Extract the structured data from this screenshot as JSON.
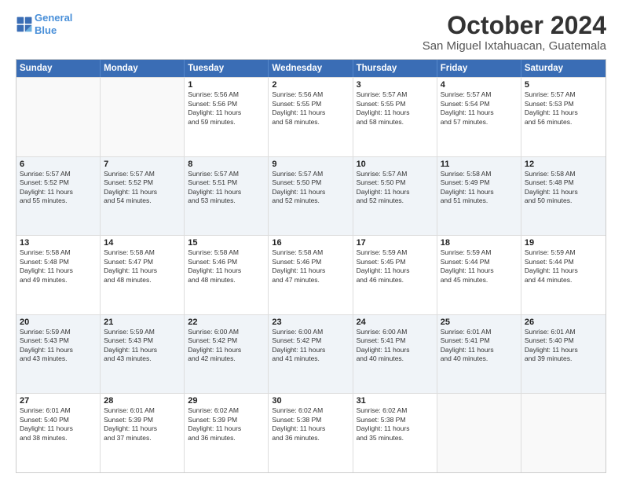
{
  "logo": {
    "line1": "General",
    "line2": "Blue"
  },
  "header": {
    "month": "October 2024",
    "location": "San Miguel Ixtahuacan, Guatemala"
  },
  "weekdays": [
    "Sunday",
    "Monday",
    "Tuesday",
    "Wednesday",
    "Thursday",
    "Friday",
    "Saturday"
  ],
  "rows": [
    {
      "alt": false,
      "cells": [
        {
          "day": "",
          "lines": []
        },
        {
          "day": "",
          "lines": []
        },
        {
          "day": "1",
          "lines": [
            "Sunrise: 5:56 AM",
            "Sunset: 5:56 PM",
            "Daylight: 11 hours",
            "and 59 minutes."
          ]
        },
        {
          "day": "2",
          "lines": [
            "Sunrise: 5:56 AM",
            "Sunset: 5:55 PM",
            "Daylight: 11 hours",
            "and 58 minutes."
          ]
        },
        {
          "day": "3",
          "lines": [
            "Sunrise: 5:57 AM",
            "Sunset: 5:55 PM",
            "Daylight: 11 hours",
            "and 58 minutes."
          ]
        },
        {
          "day": "4",
          "lines": [
            "Sunrise: 5:57 AM",
            "Sunset: 5:54 PM",
            "Daylight: 11 hours",
            "and 57 minutes."
          ]
        },
        {
          "day": "5",
          "lines": [
            "Sunrise: 5:57 AM",
            "Sunset: 5:53 PM",
            "Daylight: 11 hours",
            "and 56 minutes."
          ]
        }
      ]
    },
    {
      "alt": true,
      "cells": [
        {
          "day": "6",
          "lines": [
            "Sunrise: 5:57 AM",
            "Sunset: 5:52 PM",
            "Daylight: 11 hours",
            "and 55 minutes."
          ]
        },
        {
          "day": "7",
          "lines": [
            "Sunrise: 5:57 AM",
            "Sunset: 5:52 PM",
            "Daylight: 11 hours",
            "and 54 minutes."
          ]
        },
        {
          "day": "8",
          "lines": [
            "Sunrise: 5:57 AM",
            "Sunset: 5:51 PM",
            "Daylight: 11 hours",
            "and 53 minutes."
          ]
        },
        {
          "day": "9",
          "lines": [
            "Sunrise: 5:57 AM",
            "Sunset: 5:50 PM",
            "Daylight: 11 hours",
            "and 52 minutes."
          ]
        },
        {
          "day": "10",
          "lines": [
            "Sunrise: 5:57 AM",
            "Sunset: 5:50 PM",
            "Daylight: 11 hours",
            "and 52 minutes."
          ]
        },
        {
          "day": "11",
          "lines": [
            "Sunrise: 5:58 AM",
            "Sunset: 5:49 PM",
            "Daylight: 11 hours",
            "and 51 minutes."
          ]
        },
        {
          "day": "12",
          "lines": [
            "Sunrise: 5:58 AM",
            "Sunset: 5:48 PM",
            "Daylight: 11 hours",
            "and 50 minutes."
          ]
        }
      ]
    },
    {
      "alt": false,
      "cells": [
        {
          "day": "13",
          "lines": [
            "Sunrise: 5:58 AM",
            "Sunset: 5:48 PM",
            "Daylight: 11 hours",
            "and 49 minutes."
          ]
        },
        {
          "day": "14",
          "lines": [
            "Sunrise: 5:58 AM",
            "Sunset: 5:47 PM",
            "Daylight: 11 hours",
            "and 48 minutes."
          ]
        },
        {
          "day": "15",
          "lines": [
            "Sunrise: 5:58 AM",
            "Sunset: 5:46 PM",
            "Daylight: 11 hours",
            "and 48 minutes."
          ]
        },
        {
          "day": "16",
          "lines": [
            "Sunrise: 5:58 AM",
            "Sunset: 5:46 PM",
            "Daylight: 11 hours",
            "and 47 minutes."
          ]
        },
        {
          "day": "17",
          "lines": [
            "Sunrise: 5:59 AM",
            "Sunset: 5:45 PM",
            "Daylight: 11 hours",
            "and 46 minutes."
          ]
        },
        {
          "day": "18",
          "lines": [
            "Sunrise: 5:59 AM",
            "Sunset: 5:44 PM",
            "Daylight: 11 hours",
            "and 45 minutes."
          ]
        },
        {
          "day": "19",
          "lines": [
            "Sunrise: 5:59 AM",
            "Sunset: 5:44 PM",
            "Daylight: 11 hours",
            "and 44 minutes."
          ]
        }
      ]
    },
    {
      "alt": true,
      "cells": [
        {
          "day": "20",
          "lines": [
            "Sunrise: 5:59 AM",
            "Sunset: 5:43 PM",
            "Daylight: 11 hours",
            "and 43 minutes."
          ]
        },
        {
          "day": "21",
          "lines": [
            "Sunrise: 5:59 AM",
            "Sunset: 5:43 PM",
            "Daylight: 11 hours",
            "and 43 minutes."
          ]
        },
        {
          "day": "22",
          "lines": [
            "Sunrise: 6:00 AM",
            "Sunset: 5:42 PM",
            "Daylight: 11 hours",
            "and 42 minutes."
          ]
        },
        {
          "day": "23",
          "lines": [
            "Sunrise: 6:00 AM",
            "Sunset: 5:42 PM",
            "Daylight: 11 hours",
            "and 41 minutes."
          ]
        },
        {
          "day": "24",
          "lines": [
            "Sunrise: 6:00 AM",
            "Sunset: 5:41 PM",
            "Daylight: 11 hours",
            "and 40 minutes."
          ]
        },
        {
          "day": "25",
          "lines": [
            "Sunrise: 6:01 AM",
            "Sunset: 5:41 PM",
            "Daylight: 11 hours",
            "and 40 minutes."
          ]
        },
        {
          "day": "26",
          "lines": [
            "Sunrise: 6:01 AM",
            "Sunset: 5:40 PM",
            "Daylight: 11 hours",
            "and 39 minutes."
          ]
        }
      ]
    },
    {
      "alt": false,
      "cells": [
        {
          "day": "27",
          "lines": [
            "Sunrise: 6:01 AM",
            "Sunset: 5:40 PM",
            "Daylight: 11 hours",
            "and 38 minutes."
          ]
        },
        {
          "day": "28",
          "lines": [
            "Sunrise: 6:01 AM",
            "Sunset: 5:39 PM",
            "Daylight: 11 hours",
            "and 37 minutes."
          ]
        },
        {
          "day": "29",
          "lines": [
            "Sunrise: 6:02 AM",
            "Sunset: 5:39 PM",
            "Daylight: 11 hours",
            "and 36 minutes."
          ]
        },
        {
          "day": "30",
          "lines": [
            "Sunrise: 6:02 AM",
            "Sunset: 5:38 PM",
            "Daylight: 11 hours",
            "and 36 minutes."
          ]
        },
        {
          "day": "31",
          "lines": [
            "Sunrise: 6:02 AM",
            "Sunset: 5:38 PM",
            "Daylight: 11 hours",
            "and 35 minutes."
          ]
        },
        {
          "day": "",
          "lines": []
        },
        {
          "day": "",
          "lines": []
        }
      ]
    }
  ]
}
